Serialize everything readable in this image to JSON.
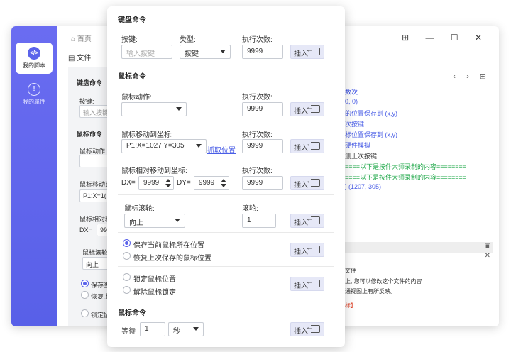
{
  "nav": {
    "items": [
      {
        "label": "我的脚本",
        "icon": "code-icon"
      },
      {
        "label": "我的属性",
        "icon": "info-icon"
      }
    ]
  },
  "topbar": {
    "home": "首页",
    "file_menu": "文件",
    "controls": "⊞ — ☐ ✕"
  },
  "background": {
    "sec1": "键盘命令",
    "key_label": "按键:",
    "key_placeholder": "输入按键",
    "sec2": "鼠标命令",
    "action_label": "鼠标动作:",
    "move_label": "鼠标移动到",
    "move_value": "P1:X=1(",
    "rel_label": "鼠标相对移",
    "rel_dx": "DX=",
    "rel_dx_val": "99",
    "wheel_label": "鼠标滚轮",
    "wheel_value": "向上",
    "save_label": "保存当",
    "restore_label": "恢复上",
    "lock_label": "锁定鼠"
  },
  "code": {
    "nav": "‹ › ⊞",
    "lines": [
      {
        "text": "数次",
        "color": "#4a5ee6"
      },
      {
        "text": "0, 0)",
        "color": "#4a5ee6"
      },
      {
        "text": "的位置保存到 (x,y)",
        "color": "#4a5ee6"
      },
      {
        "text": "次按键",
        "color": "#4a5ee6"
      },
      {
        "text": "标位置保存到 (x,y)",
        "color": "#4a5ee6"
      },
      {
        "text": "硬件模拟",
        "color": "#4a5ee6"
      },
      {
        "text": "测上次按键",
        "color": "#333333"
      },
      {
        "text": "====以下是按件大师录制的内容========",
        "color": "#20a84a"
      },
      {
        "text": "====以下是按件大师录制的内容========",
        "color": "#20a84a"
      },
      {
        "text": "] (1207, 305)",
        "color": "#4a5ee6"
      }
    ],
    "panel_icon": "▣",
    "close": "✕",
    "info": [
      "文件",
      "上, 您可以修改这个文件的内容",
      "通视图上有所反映。",
      "标】"
    ]
  },
  "popup": {
    "keyboard": {
      "title": "键盘命令",
      "key_label": "按键:",
      "key_placeholder": "输入按键",
      "type_label": "类型:",
      "type_value": "按键",
      "count_label": "执行次数:",
      "count_value": "9999",
      "insert": "插入"
    },
    "mouse": {
      "title": "鼠标命令",
      "action_label": "鼠标动作:",
      "action_value": "",
      "action_count_label": "执行次数:",
      "action_count": "9999",
      "move_label": "鼠标移动到坐标:",
      "move_value": "P1:X=1027 Y=305",
      "capture_link": "抓取位置",
      "move_count_label": "执行次数:",
      "move_count": "9999",
      "rel_label": "鼠标相对移动到坐标:",
      "dx_label": "DX=",
      "dx_value": "9999",
      "dy_label": "DY=",
      "dy_value": "9999",
      "rel_count_label": "执行次数:",
      "rel_count": "9999",
      "wheel_label": "鼠标滚轮:",
      "wheel_value": "向上",
      "wheel_count_label": "滚轮:",
      "wheel_count": "1",
      "save_pos": "保存当前鼠标所在位置",
      "restore_pos": "恢复上次保存的鼠标位置",
      "lock_pos": "锁定鼠标位置",
      "unlock_pos": "解除鼠标锁定",
      "insert": "插入"
    },
    "wait": {
      "title": "鼠标命令",
      "label": "等待",
      "value": "1",
      "unit": "秒",
      "insert": "插入"
    }
  }
}
